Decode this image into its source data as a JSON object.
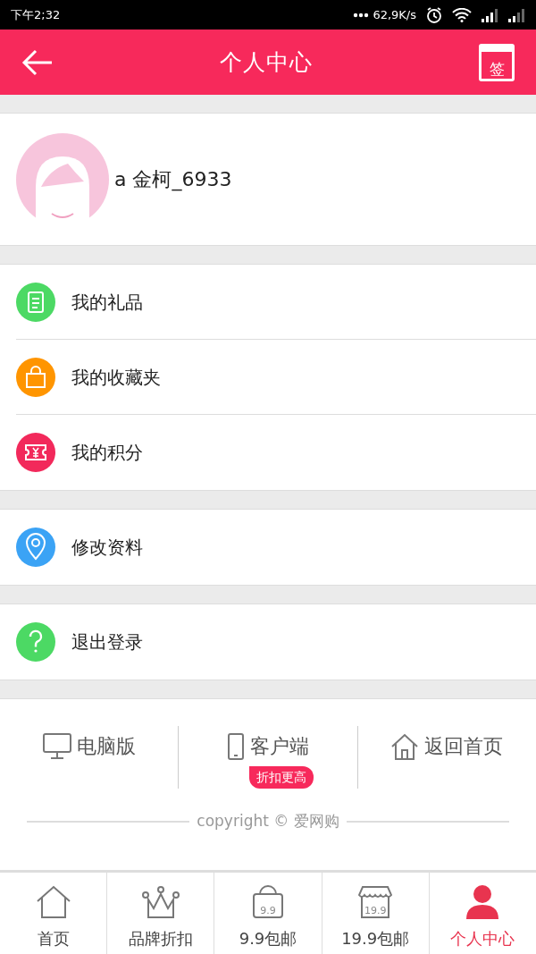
{
  "status_bar": {
    "time": "下午2;32",
    "speed": "62,9K/s"
  },
  "header": {
    "title": "个人中心",
    "sign_label": "签"
  },
  "profile": {
    "username": "a 金柯_6933"
  },
  "menu_groups": [
    {
      "items": [
        {
          "label": "我的礼品",
          "kind": "gift",
          "color": "#4cd964"
        },
        {
          "label": "我的收藏夹",
          "kind": "bag",
          "color": "#ff9500"
        },
        {
          "label": "我的积分",
          "kind": "coupon",
          "color": "#f2295b"
        }
      ]
    },
    {
      "items": [
        {
          "label": "修改资料",
          "kind": "pin",
          "color": "#3ba3f5"
        }
      ]
    },
    {
      "items": [
        {
          "label": "退出登录",
          "kind": "help",
          "color": "#4cd964"
        }
      ]
    }
  ],
  "footer_links": [
    {
      "label": "电脑版",
      "kind": "monitor"
    },
    {
      "label": "客户端",
      "kind": "phone",
      "badge": "折扣更高"
    },
    {
      "label": "返回首页",
      "kind": "home"
    }
  ],
  "copyright": "copyright © 爱网购",
  "bottom_nav": [
    {
      "label": "首页",
      "kind": "home",
      "selected": false
    },
    {
      "label": "品牌折扣",
      "kind": "crown",
      "selected": false
    },
    {
      "label": "9.9包邮",
      "kind": "bag",
      "icon_text": "9.9",
      "selected": false
    },
    {
      "label": "19.9包邮",
      "kind": "shop",
      "icon_text": "19.9",
      "selected": false
    },
    {
      "label": "个人中心",
      "kind": "person",
      "selected": true
    }
  ]
}
